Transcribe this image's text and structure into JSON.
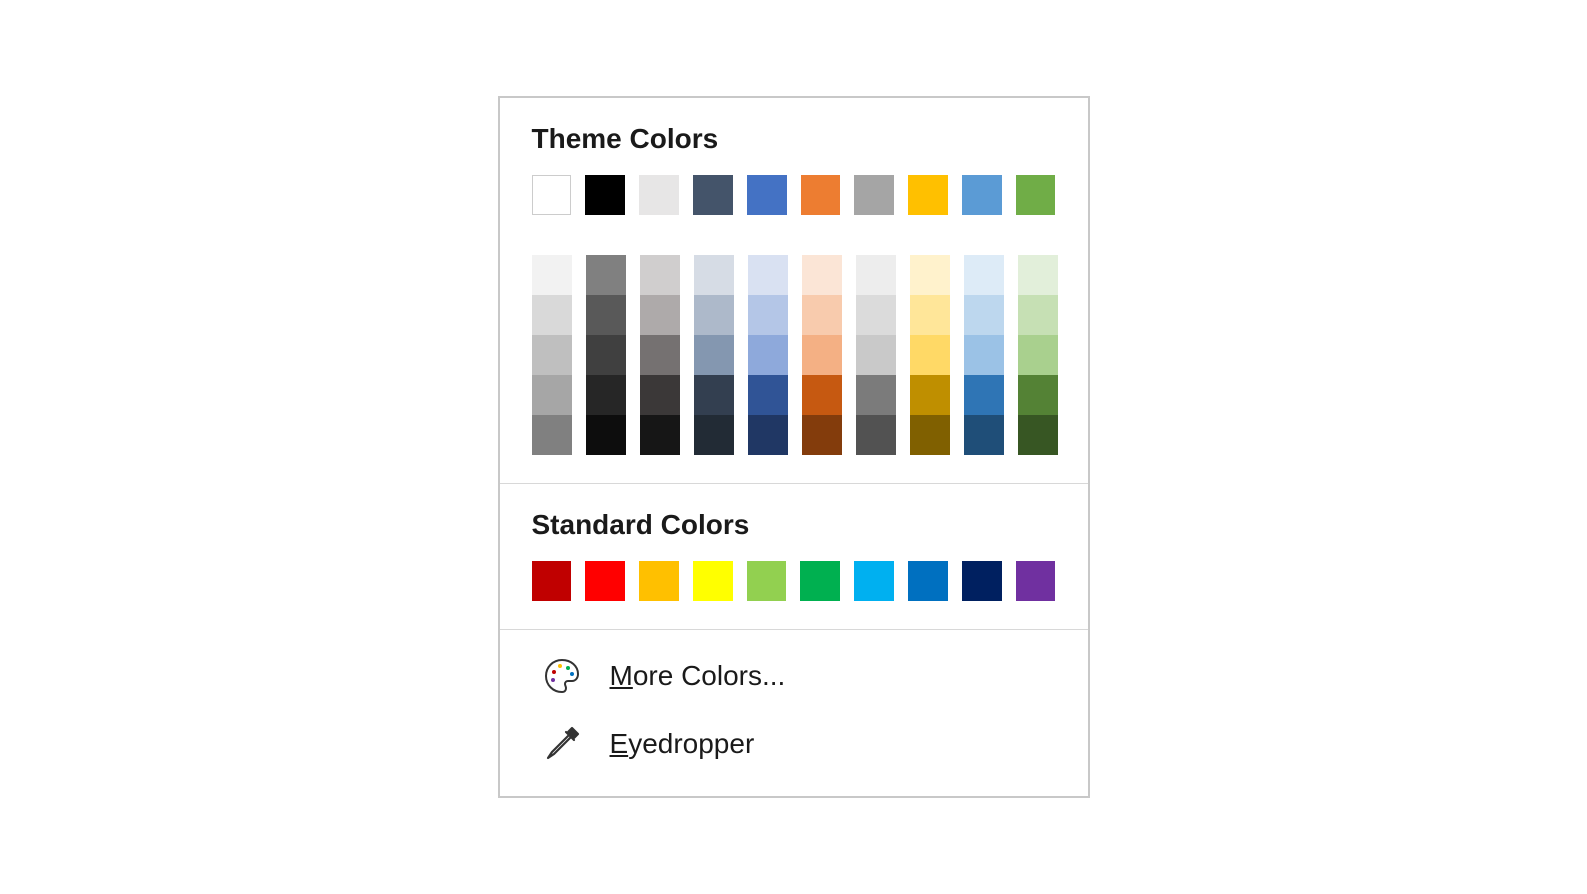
{
  "themeColors": {
    "title": "Theme Colors",
    "row": [
      {
        "hex": "#FFFFFF",
        "bordered": true
      },
      {
        "hex": "#000000"
      },
      {
        "hex": "#E7E6E6"
      },
      {
        "hex": "#44546A"
      },
      {
        "hex": "#4472C4"
      },
      {
        "hex": "#ED7D31"
      },
      {
        "hex": "#A5A5A5"
      },
      {
        "hex": "#FFC000"
      },
      {
        "hex": "#5B9BD5"
      },
      {
        "hex": "#70AD47"
      }
    ],
    "shades": [
      [
        "#F2F2F2",
        "#D9D9D9",
        "#BFBFBF",
        "#A6A6A6",
        "#808080"
      ],
      [
        "#808080",
        "#595959",
        "#404040",
        "#262626",
        "#0D0D0D"
      ],
      [
        "#D0CECE",
        "#AEAAAA",
        "#757171",
        "#3B3838",
        "#161616"
      ],
      [
        "#D6DCE5",
        "#ADB9CA",
        "#8497B0",
        "#333F50",
        "#222B35"
      ],
      [
        "#D9E1F2",
        "#B4C6E7",
        "#8EA9DB",
        "#305496",
        "#203764"
      ],
      [
        "#FBE5D6",
        "#F8CBAD",
        "#F4B084",
        "#C65911",
        "#833C0C"
      ],
      [
        "#EDEDED",
        "#DBDBDB",
        "#C9C9C9",
        "#7B7B7B",
        "#525252"
      ],
      [
        "#FFF2CC",
        "#FFE699",
        "#FFD966",
        "#BF8F00",
        "#806000"
      ],
      [
        "#DDEBF7",
        "#BDD7EE",
        "#9BC2E6",
        "#2F75B5",
        "#1F4E78"
      ],
      [
        "#E2EFDA",
        "#C6E0B4",
        "#A9D08E",
        "#548235",
        "#375623"
      ]
    ]
  },
  "standardColors": {
    "title": "Standard Colors",
    "row": [
      {
        "hex": "#C00000"
      },
      {
        "hex": "#FF0000"
      },
      {
        "hex": "#FFC000"
      },
      {
        "hex": "#FFFF00"
      },
      {
        "hex": "#92D050"
      },
      {
        "hex": "#00B050"
      },
      {
        "hex": "#00B0F0"
      },
      {
        "hex": "#0070C0"
      },
      {
        "hex": "#002060"
      },
      {
        "hex": "#7030A0"
      }
    ]
  },
  "menu": {
    "moreColors": {
      "mnemonic": "M",
      "rest": "ore Colors..."
    },
    "eyedropper": {
      "mnemonic": "E",
      "rest": "yedropper"
    }
  }
}
